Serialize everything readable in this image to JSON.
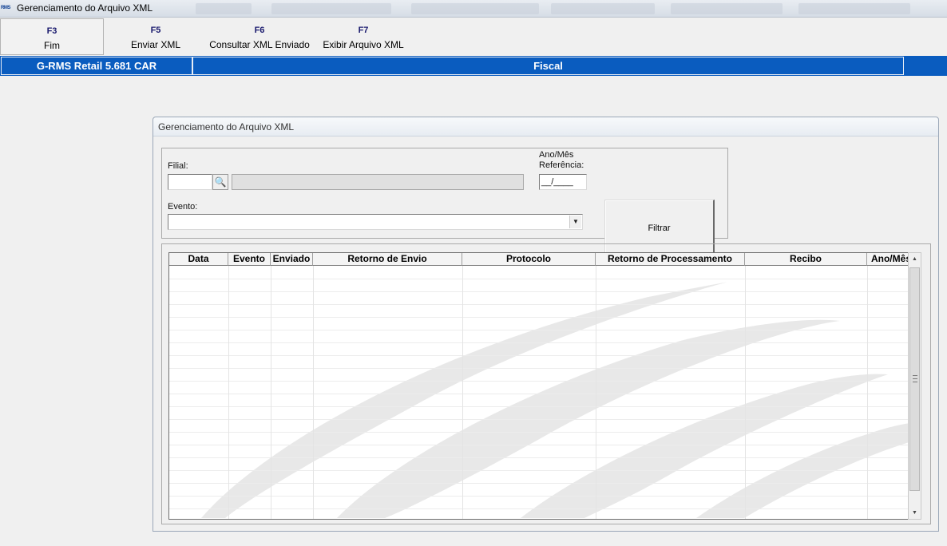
{
  "window": {
    "app_icon_text": "RMS",
    "title": "Gerenciamento do Arquivo XML"
  },
  "toolbar": {
    "keys": [
      {
        "key": "F3",
        "label": "Fim"
      },
      {
        "key": "F5",
        "label": "Enviar XML"
      },
      {
        "key": "F6",
        "label": "Consultar XML Enviado"
      },
      {
        "key": "F7",
        "label": "Exibir Arquivo XML"
      }
    ]
  },
  "module_bar": {
    "product": "G-RMS Retail 5.681 CAR",
    "module": "Fiscal"
  },
  "panel": {
    "title": "Gerenciamento do Arquivo XML",
    "filter": {
      "filial_label": "Filial:",
      "filial_value": "",
      "filial_description": "",
      "anomes_label": "Ano/Mês Referência:",
      "anomes_value": "__/____",
      "evento_label": "Evento:",
      "evento_value": "",
      "filtrar_label": "Filtrar"
    },
    "grid": {
      "columns": [
        "Data",
        "Evento",
        "Enviado",
        "Retorno de Envio",
        "Protocolo",
        "Retorno de Processamento",
        "Recibo",
        "Ano/Mês"
      ],
      "rows": []
    }
  },
  "colors": {
    "module_bar": "#0a5cbf",
    "function_key": "#1a1a6e",
    "watermark": "#e6e6e6"
  },
  "icons": {
    "search": "binoculars-icon",
    "dropdown": "chevron-down-icon"
  }
}
